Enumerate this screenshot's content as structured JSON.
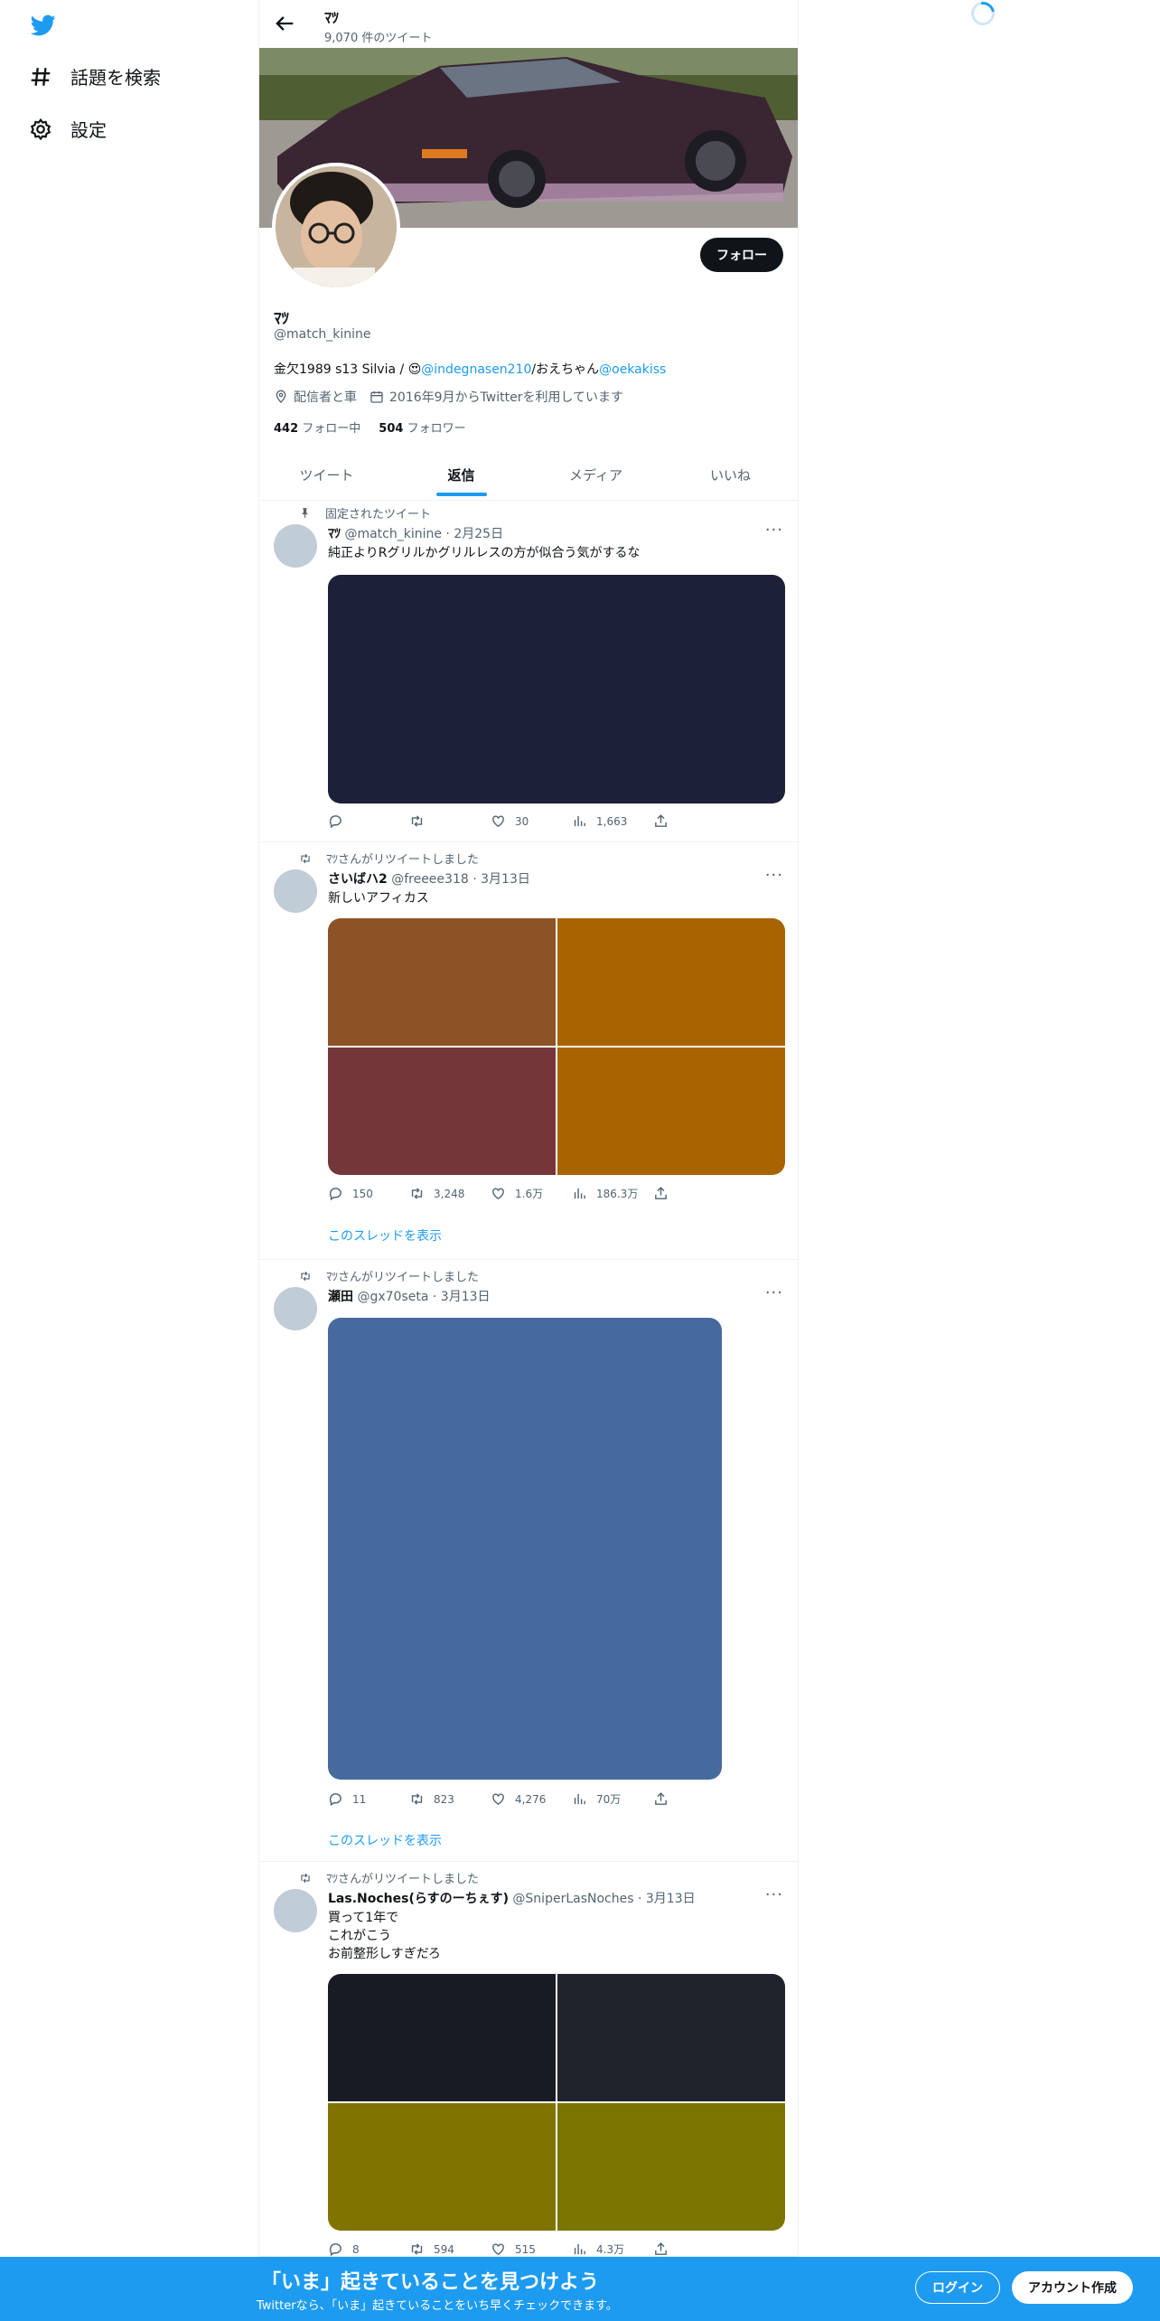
{
  "sidebar": {
    "explore_label": "話題を検索",
    "settings_label": "設定"
  },
  "header": {
    "name": "ﾏﾂ",
    "tweet_count": "9,070 件のツイート"
  },
  "profile": {
    "name": "ﾏﾂ",
    "handle": "@match_kinine",
    "follow_label": "フォロー",
    "bio_text_1": "金欠1989 s13 Silvia / ",
    "bio_emoji": "😍",
    "bio_link_1": "@indegnasen210",
    "bio_text_2": "/おえちゃん",
    "bio_link_2": "@oekakiss",
    "location": "配信者と車",
    "joined": "2016年9月からTwitterを利用しています",
    "following_count": "442",
    "following_label": "フォロー中",
    "followers_count": "504",
    "followers_label": "フォロワー"
  },
  "tabs": [
    "ツイート",
    "返信",
    "メディア",
    "いいね"
  ],
  "tweets": [
    {
      "context": "固定されたツイート",
      "name": "ﾏﾂ",
      "handle": "@match_kinine",
      "date": "2月25日",
      "text": "純正よりRグリルかグリルレスの方が似合う気がするな",
      "media_colors": [
        "#1c2039"
      ],
      "replies": "",
      "retweets": "",
      "likes": "30",
      "views": "1,663",
      "thread": ""
    },
    {
      "context": "ﾏﾂさんがリツイートしました",
      "name": "さいばハ2",
      "handle": "@freeee318",
      "date": "3月13日",
      "text": "新しいアフィカス",
      "media_colors": [
        "#8b5326",
        "#a86400",
        "#75363a",
        "#a86400"
      ],
      "replies": "150",
      "retweets": "3,248",
      "likes": "1.6万",
      "views": "186.3万",
      "thread": "このスレッドを表示"
    },
    {
      "context": "ﾏﾂさんがリツイートしました",
      "name": "瀬田",
      "handle": "@gx70seta",
      "date": "3月13日",
      "text": "",
      "media_colors": [
        "#466a9d"
      ],
      "replies": "11",
      "retweets": "823",
      "likes": "4,276",
      "views": "70万",
      "thread": "このスレッドを表示"
    },
    {
      "context": "ﾏﾂさんがリツイートしました",
      "name": "Las.Noches(らすのーちぇす)",
      "handle": "@SniperLasNoches",
      "date": "3月13日",
      "text_lines": [
        "買って1年で",
        "これがこう",
        "お前整形しすぎだろ"
      ],
      "media_colors": [
        "#181b24",
        "#20232c",
        "#807300",
        "#7a7500"
      ],
      "replies": "8",
      "retweets": "594",
      "likes": "515",
      "views": "4.3万",
      "thread": ""
    }
  ],
  "bottom_bar": {
    "headline": "「いま」起きていることを見つけよう",
    "subtext": "Twitterなら、「いま」起きていることをいち早くチェックできます。",
    "login_label": "ログイン",
    "signup_label": "アカウント作成"
  },
  "colors": {
    "accent": "#1d9bf0",
    "text": "#0f1419",
    "muted": "#536471"
  }
}
